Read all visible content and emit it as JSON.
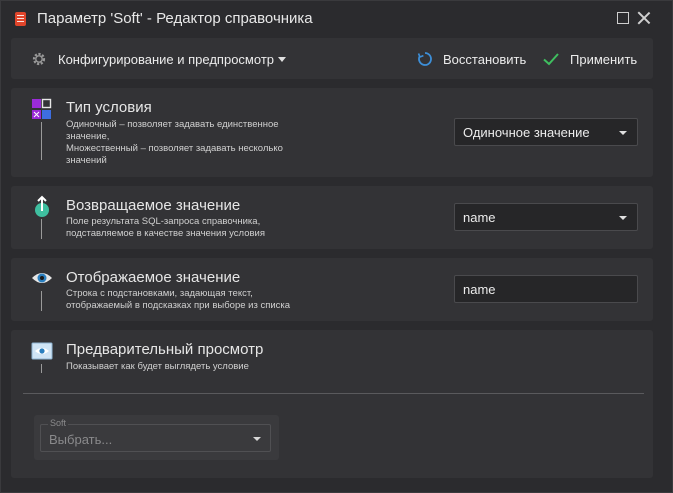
{
  "window": {
    "title": "Параметр 'Soft' - Редактор справочника"
  },
  "toolbar": {
    "config_label": "Конфигурирование и предпросмотр",
    "restore_label": "Восстановить",
    "apply_label": "Применить"
  },
  "sections": [
    {
      "title": "Тип условия",
      "description": "Одиночный – позволяет задавать единственное значение,\nМножественный – позволяет задавать несколько значений",
      "field_value": "Одиночное значение",
      "icon": "condition-type-icon"
    },
    {
      "title": "Возвращаемое значение",
      "description": "Поле результата SQL-запроса справочника, подставляемое в качестве значения условия",
      "field_value": "name",
      "icon": "return-value-icon"
    },
    {
      "title": "Отображаемое значение",
      "description": "Строка с подстановками, задающая текст, отображаемый в подсказках при выборе из списка",
      "field_value": "name",
      "icon": "eye-icon"
    },
    {
      "title": "Предварительный просмотр",
      "description": "Показывает как будет выглядеть условие",
      "icon": "preview-icon"
    }
  ],
  "preview": {
    "legend": "Soft",
    "placeholder": "Выбрать..."
  },
  "colors": {
    "accent_blue": "#3d8fd8",
    "accent_green": "#3fbf5f",
    "brand_red": "#e0452b"
  }
}
